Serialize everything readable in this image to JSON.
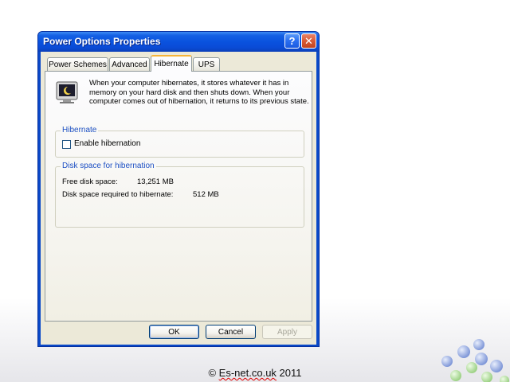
{
  "window": {
    "title": "Power Options Properties",
    "help_label": "?",
    "close_label": "✕"
  },
  "tabs": [
    {
      "label": "Power Schemes",
      "active": false
    },
    {
      "label": "Advanced",
      "active": false
    },
    {
      "label": "Hibernate",
      "active": true
    },
    {
      "label": "UPS",
      "active": false
    }
  ],
  "hibernate_tab": {
    "icon": "computer-icon",
    "description": "When your computer hibernates, it stores whatever it has in memory on your hard disk and then shuts down. When your computer comes out of hibernation, it returns to its previous state.",
    "hibernate_group": {
      "legend": "Hibernate",
      "checkbox_label": "Enable hibernation",
      "checked": false
    },
    "disk_group": {
      "legend": "Disk space for hibernation",
      "free_label": "Free disk space:",
      "free_value": "13,251 MB",
      "required_label": "Disk space required to hibernate:",
      "required_value": "512 MB"
    }
  },
  "buttons": {
    "ok": "OK",
    "cancel": "Cancel",
    "apply": "Apply"
  },
  "footer": {
    "copyright_prefix": "© ",
    "copyright_site": "Es-net.co.uk",
    "copyright_year": " 2011"
  },
  "colors": {
    "titlebar": "#0a52de",
    "dialog_face": "#ece9d8",
    "group_legend": "#1c4fc4",
    "active_tab_accent": "#f7b439"
  }
}
